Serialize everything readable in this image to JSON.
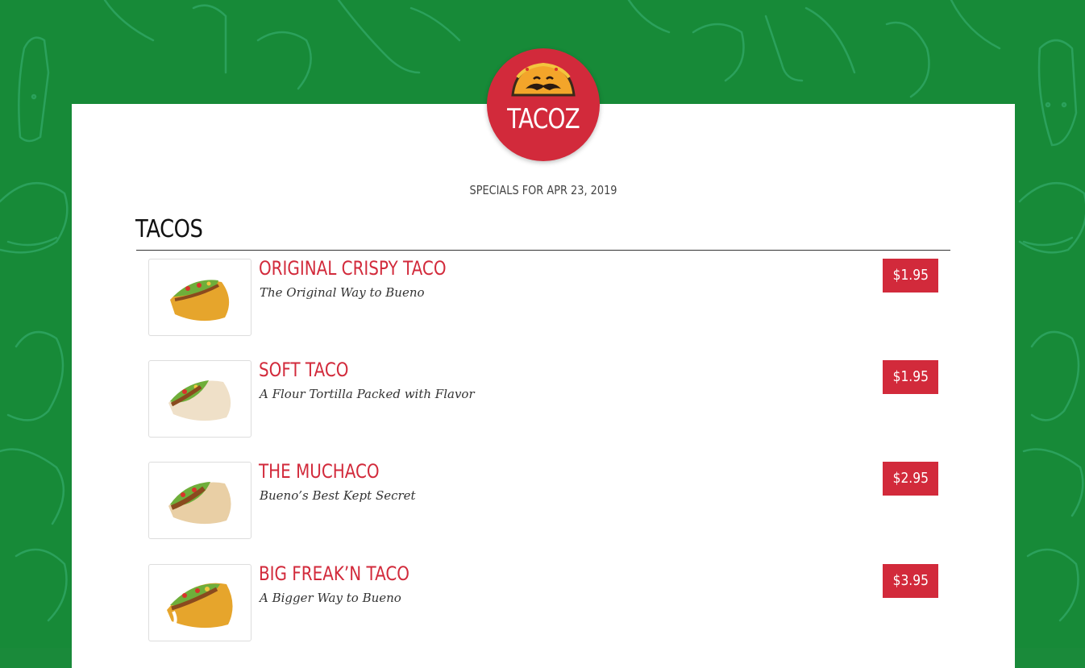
{
  "brand": {
    "name": "TACOZ",
    "logo_icon": "mustache-taco-icon",
    "accent": "#d22a3b",
    "background": "#1a8a3a"
  },
  "specials_label": "SPECIALS FOR APR 23, 2019",
  "section": {
    "title": "TACOS"
  },
  "items": [
    {
      "name": "ORIGINAL CRISPY TACO",
      "description": "The Original Way to Bueno",
      "price": "$1.95",
      "image": "crispy-taco-image"
    },
    {
      "name": "SOFT TACO",
      "description": "A Flour Tortilla Packed with Flavor",
      "price": "$1.95",
      "image": "soft-taco-image"
    },
    {
      "name": "THE MUCHACO",
      "description": "Bueno’s Best Kept Secret",
      "price": "$2.95",
      "image": "muchaco-image"
    },
    {
      "name": "BIG FREAK’N TACO",
      "description": "A Bigger Way to Bueno",
      "price": "$3.95",
      "image": "big-taco-image"
    }
  ]
}
